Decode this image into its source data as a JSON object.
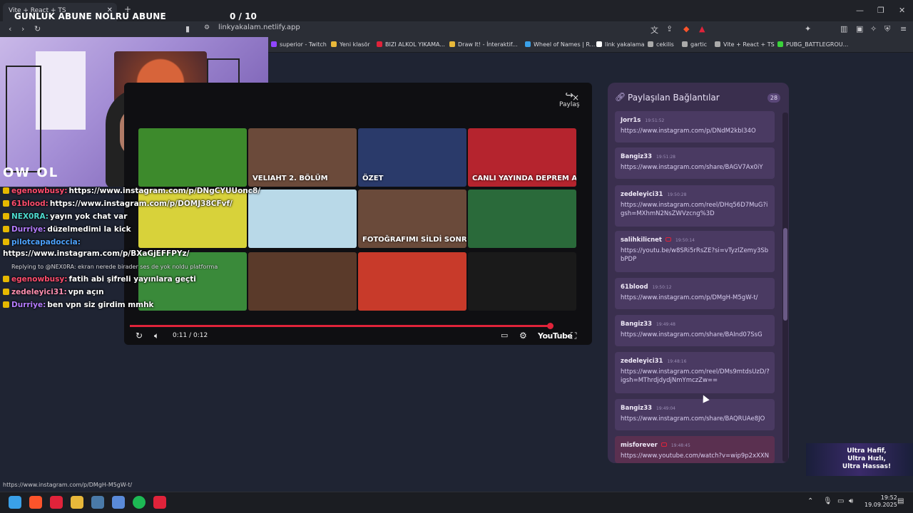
{
  "browser": {
    "tab_title": "Vite + React + TS",
    "new_tab_glyph": "+",
    "url": "linkyakalam.netlify.app",
    "bookmarks": [
      {
        "label": "superior - Twitch",
        "color": "#9146ff"
      },
      {
        "label": "Yeni klasör",
        "color": "#e8b83a"
      },
      {
        "label": "BIZI ALKOL YIKAMA...",
        "color": "#e0233a"
      },
      {
        "label": "Draw It! - İnteraktif...",
        "color": "#e8b83a"
      },
      {
        "label": "Wheel of Names | R...",
        "color": "#3aa0e8"
      },
      {
        "label": "link yakalama",
        "color": "#ffffff"
      },
      {
        "label": "cekilis",
        "color": "#aaaaaa"
      },
      {
        "label": "gartic",
        "color": "#aaaaaa"
      },
      {
        "label": "Vite + React + TS",
        "color": "#aaaaaa"
      },
      {
        "label": "PUBG_BATTLEGROU...",
        "color": "#3ad23a"
      }
    ]
  },
  "overlay": {
    "title": "GUNLUK ABUNE NOLRU ABUNE",
    "count": "0  / 10",
    "cam_logo": "OW OL"
  },
  "chat": [
    {
      "user": "egenowbusy:",
      "user_color": "#ff4d6d",
      "msg": "https://www.instagram.com/p/DNgCYUUonc8/"
    },
    {
      "user": "61blood:",
      "user_color": "#ff4d6d",
      "msg": "https://www.instagram.com/p/DOMJ38CFvf/"
    },
    {
      "user": "NEX0RA:",
      "user_color": "#4ddbd0",
      "msg": "yayın yok chat var"
    },
    {
      "user": "Durriye:",
      "user_color": "#b57cff",
      "msg": "düzelmedimi la kick"
    },
    {
      "user": "pilotcapadoccia:",
      "user_color": "#4da3ff",
      "msg": ""
    },
    {
      "user": "",
      "user_color": "#ffffff",
      "msg": "https://www.instagram.com/p/BXaGjEFFPYz/"
    },
    {
      "user": "egenowbusy:",
      "user_color": "#ff4d6d",
      "msg": "fatih abi şifreli yayınlara geçti"
    },
    {
      "user": "zedeleyici31:",
      "user_color": "#ff8fb0",
      "msg": "vpn açın"
    },
    {
      "user": "Durriye:",
      "user_color": "#b57cff",
      "msg": "ben vpn siz girdim mmhk"
    }
  ],
  "chat_reply": "Replying to @NEX0RA: ekran nerede birader ses de yok noldu platforma",
  "player": {
    "share_label": "Paylaş",
    "close_glyph": "×",
    "time": "0:11 / 0:12",
    "youtube_label": "YouTube",
    "progress": 0.92,
    "thumbs": [
      {
        "caption": "",
        "bg": "#3d8a2c"
      },
      {
        "caption": "VELIAHT 2. BÖLÜM",
        "bg": "#6b4a3a"
      },
      {
        "caption": "ÖZET",
        "bg": "#2a3a6a"
      },
      {
        "caption": "CANLI YAYINDA DEPREM ANI!",
        "bg": "#b5242e"
      },
      {
        "caption": "",
        "bg": "#d8d23a"
      },
      {
        "caption": "",
        "bg": "#b9d9e8"
      },
      {
        "caption": "FOTOĞRAFIMI SİLDİ SONRA BENİ ARADI...",
        "bg": "#6a4a3a"
      },
      {
        "caption": "",
        "bg": "#2a6a3a"
      },
      {
        "caption": "",
        "bg": "#3a8a3a"
      },
      {
        "caption": "",
        "bg": "#5a3a2a"
      },
      {
        "caption": "",
        "bg": "#c83a2a"
      },
      {
        "caption": "",
        "bg": "#1a1a1a"
      }
    ]
  },
  "links_panel": {
    "title": "Paylaşılan Bağlantılar",
    "count": "28",
    "items": [
      {
        "user": "Jorr1s",
        "time": "19:51:52",
        "url": "https://www.instagram.com/p/DNdM2kbI34O",
        "yt": false
      },
      {
        "user": "Bangiz33",
        "time": "19:51:28",
        "url": "https://www.instagram.com/share/BAGV7Ax0iY",
        "yt": false
      },
      {
        "user": "zedeleyici31",
        "time": "19:50:28",
        "url": "https://www.instagram.com/reel/DHq56D7MuG?igsh=MXhmN2NsZWVzcng%3D",
        "yt": false
      },
      {
        "user": "salihkilicnet",
        "time": "19:50:14",
        "url": "https://youtu.be/w8SRi5rRsZE?si=vTyzlZemy3SbbPDP",
        "yt": true
      },
      {
        "user": "61blood",
        "time": "19:50:12",
        "url": "https://www.instagram.com/p/DMgH-M5gW-t/",
        "yt": false
      },
      {
        "user": "Bangiz33",
        "time": "19:49:48",
        "url": "https://www.instagram.com/share/BAInd07SsG",
        "yt": false
      },
      {
        "user": "zedeleyici31",
        "time": "19:48:16",
        "url": "https://www.instagram.com/reel/DMs9mtdsUzD/?igsh=MThrdjdydjNmYmczZw==",
        "yt": false
      },
      {
        "user": "Bangiz33",
        "time": "19:49:04",
        "url": "https://www.instagram.com/share/BAQRUAe8JO",
        "yt": false
      },
      {
        "user": "misforever",
        "time": "19:48:45",
        "url": "https://www.youtube.com/watch?v=wip9p2xXXN",
        "yt": true
      }
    ]
  },
  "promo": {
    "line1": "Ultra Hafif,",
    "line2": "Ultra Hızlı,",
    "line3": "Ultra Hassas!"
  },
  "status_url": "https://www.instagram.com/p/DMgH-M5gW-t/",
  "taskbar": {
    "icons": [
      "windows-icon",
      "brave-icon",
      "maps-icon",
      "files-icon",
      "steam-icon",
      "app-icon",
      "spotify-icon",
      "app2-icon"
    ],
    "time": "19:52",
    "date": "19.09.2025"
  }
}
